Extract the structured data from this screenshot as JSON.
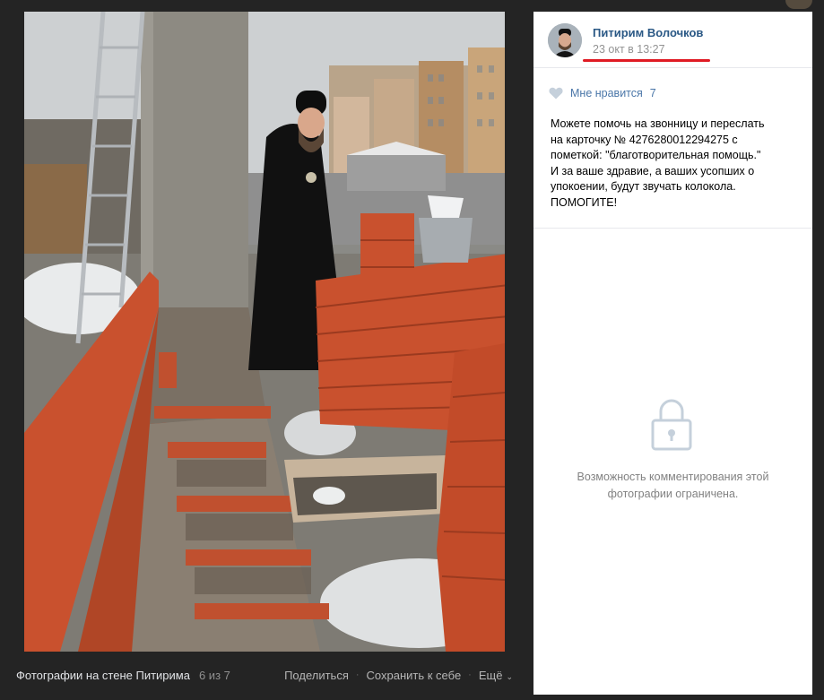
{
  "photo": {
    "description_icon": "photo-construction-site"
  },
  "bottom_bar": {
    "album_title": "Фотографии на стене Питирима",
    "counter": "6 из 7",
    "share_label": "Поделиться",
    "save_label": "Сохранить к себе",
    "more_label": "Ещё"
  },
  "post": {
    "author": "Питирим Волочков",
    "date": "23 окт в 13:27",
    "like_label": "Мне нравится",
    "like_count": "7",
    "text_lines": [
      "Можете помочь на звонницу и переслать",
      "на карточку № 4276280012294275 с",
      "пометкой: \"благотворительная помощь.\"",
      "И за ваше здравие, а ваших усопших о",
      "упокоении, будут звучать колокола.",
      "ПОМОГИТЕ!"
    ]
  },
  "comments": {
    "restricted_line1": "Возможность комментирования этой",
    "restricted_line2": "фотографии ограничена."
  },
  "colors": {
    "link": "#2a5885",
    "accent": "#4a76a8",
    "highlight": "#e01b24",
    "brick": "#c9512e"
  }
}
